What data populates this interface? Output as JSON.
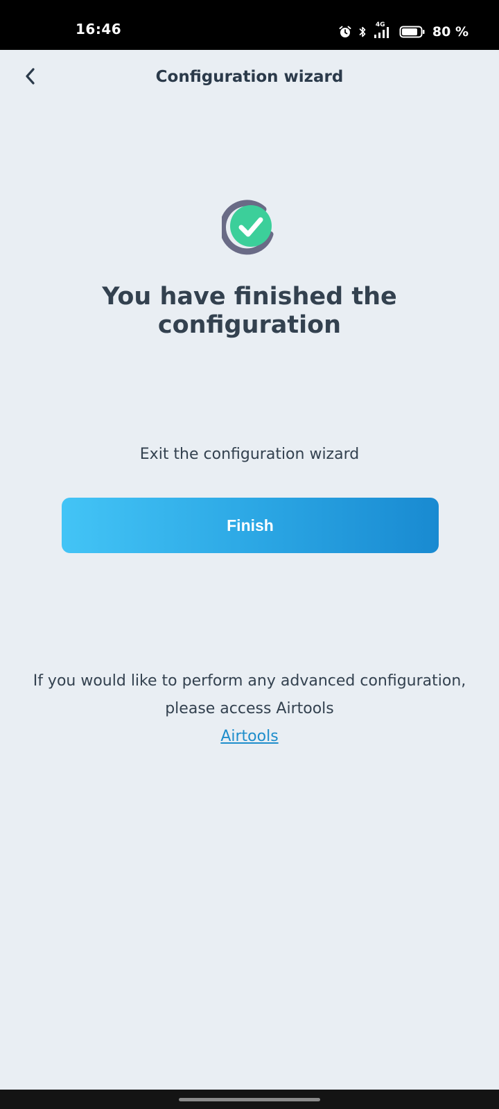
{
  "status_bar": {
    "time": "16:46",
    "network": "4G",
    "battery": "80 %"
  },
  "header": {
    "title": "Configuration wizard",
    "back_icon": "chevron-left-icon"
  },
  "main": {
    "success_icon": "check-circle-icon",
    "headline_line1": "You have finished the",
    "headline_line2": "configuration",
    "exit_text": "Exit the configuration wizard",
    "finish_label": "Finish",
    "advanced_line1": "If you would like to perform any advanced configuration,",
    "advanced_line2": "please access Airtools",
    "airtools_link": "Airtools"
  },
  "colors": {
    "background": "#e9eef3",
    "text": "#33414f",
    "accent": "#2aa5e3",
    "link": "#1d8dcb",
    "check_green": "#3ccf9a",
    "ring_gray": "#6a6b86"
  }
}
